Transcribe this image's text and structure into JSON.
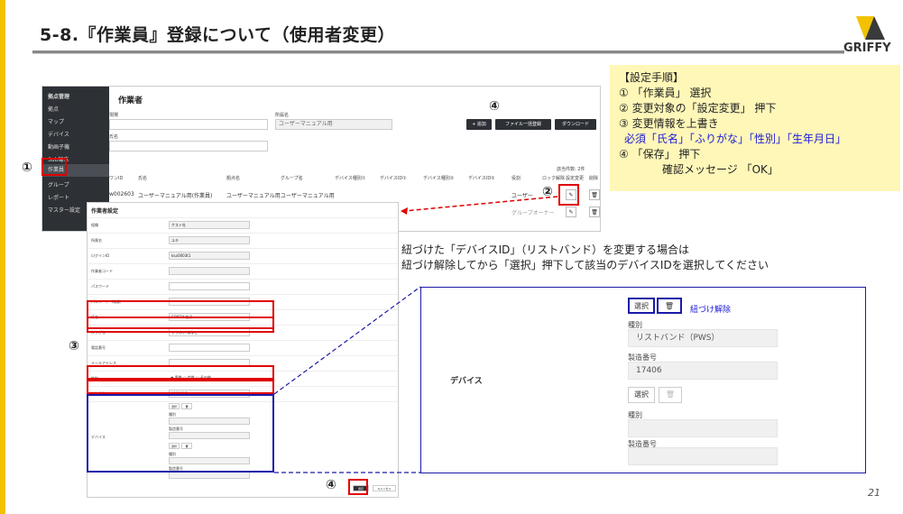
{
  "slide": {
    "title": "5-8.『作業員』登録について（使用者変更）",
    "logo_text": "GRIFFY",
    "page_number": "21",
    "accent_color": "#f2c200"
  },
  "app": {
    "sidebar": [
      "拠点管理",
      "拠点",
      "マップ",
      "デバイス",
      "動画子機",
      "Sub端末",
      "作業員",
      "グループ",
      "レポート",
      "マスター設定"
    ],
    "page_title": "作業者",
    "fields": {
      "org_label": "現場",
      "bumon_label": "所属名",
      "bumon_value": "ユーザーマニュアル用",
      "name_label": "氏名"
    },
    "toolbar": {
      "add": "+ 追加",
      "file": "ファイル一括登録",
      "download": "ダウンロード"
    },
    "table": {
      "count": "該当件数: 2件",
      "headers": [
        "ワンID",
        "氏名",
        "",
        "",
        "拠点名",
        "グループ名",
        "デバイス種別①",
        "デバイスID①",
        "デバイス種別②",
        "デバイスID②",
        "役割",
        "ロック解除",
        "設定変更",
        "削除"
      ],
      "rows": [
        {
          "id": "w002603",
          "name": "ユーザーマニュアル用(作業員)",
          "site": "ユーザーマニュアル用",
          "group": "ユーザーマニュアル用",
          "role": "ユーザー"
        },
        {
          "role": "グループオーナー"
        }
      ]
    }
  },
  "form": {
    "title": "作業者設定",
    "rows": [
      {
        "label": "組織",
        "value": "ケスト社"
      },
      {
        "label": "所属名",
        "value": "ユキ"
      },
      {
        "label": "ログインID",
        "value": "kiui0003t1"
      },
      {
        "label": "作業者コード",
        "value": ""
      },
      {
        "label": "パスワード",
        "value": ""
      },
      {
        "label": "パスワード（確認）",
        "value": ""
      },
      {
        "label": "氏名",
        "value": "GRIFFY 花子"
      },
      {
        "label": "ふりがな",
        "value": "ぐりふぃ はなこ"
      },
      {
        "label": "電話番号",
        "value": ""
      },
      {
        "label": "メールアドレス",
        "value": ""
      },
      {
        "label": "性別",
        "value": "◉ 男性 ○ 女性 ○ その他"
      },
      {
        "label": "生年月日",
        "value": "1990/1/1"
      }
    ],
    "device_label": "デバイス",
    "device_fields": [
      "種別",
      "製造番号",
      "種別",
      "製造番号"
    ],
    "select_btn": "選択",
    "save_btn": "保存",
    "cancel_btn": "キャンセル"
  },
  "markers": [
    "①",
    "②",
    "③",
    "④",
    "④",
    "④"
  ],
  "instructions": {
    "heading": "【設定手順】",
    "steps": [
      "① 「作業員」 選択",
      "② 変更対象の「設定変更」 押下",
      "③ 変更情報を上書き"
    ],
    "required": "必須「氏名」「ふりがな」「性別」「生年月日」",
    "step4": "④ 「保存」 押下",
    "step4_sub": "確認メッセージ 「OK」"
  },
  "note": {
    "line1": "紐づけた「デバイスID」（リストバンド）を変更する場合は",
    "line2": "紐づけ解除してから「選択」押下して該当のデバイスIDを選択してください"
  },
  "device_panel": {
    "section_label": "デバイス",
    "select_label": "選択",
    "unlink_label": "紐づけ解除",
    "type_label": "種別",
    "type_value": "リストバンド（PWS）",
    "serial_label": "製造番号",
    "serial_value": "17406",
    "select_label2": "選択",
    "type_label2": "種別",
    "serial_label2": "製造番号"
  }
}
